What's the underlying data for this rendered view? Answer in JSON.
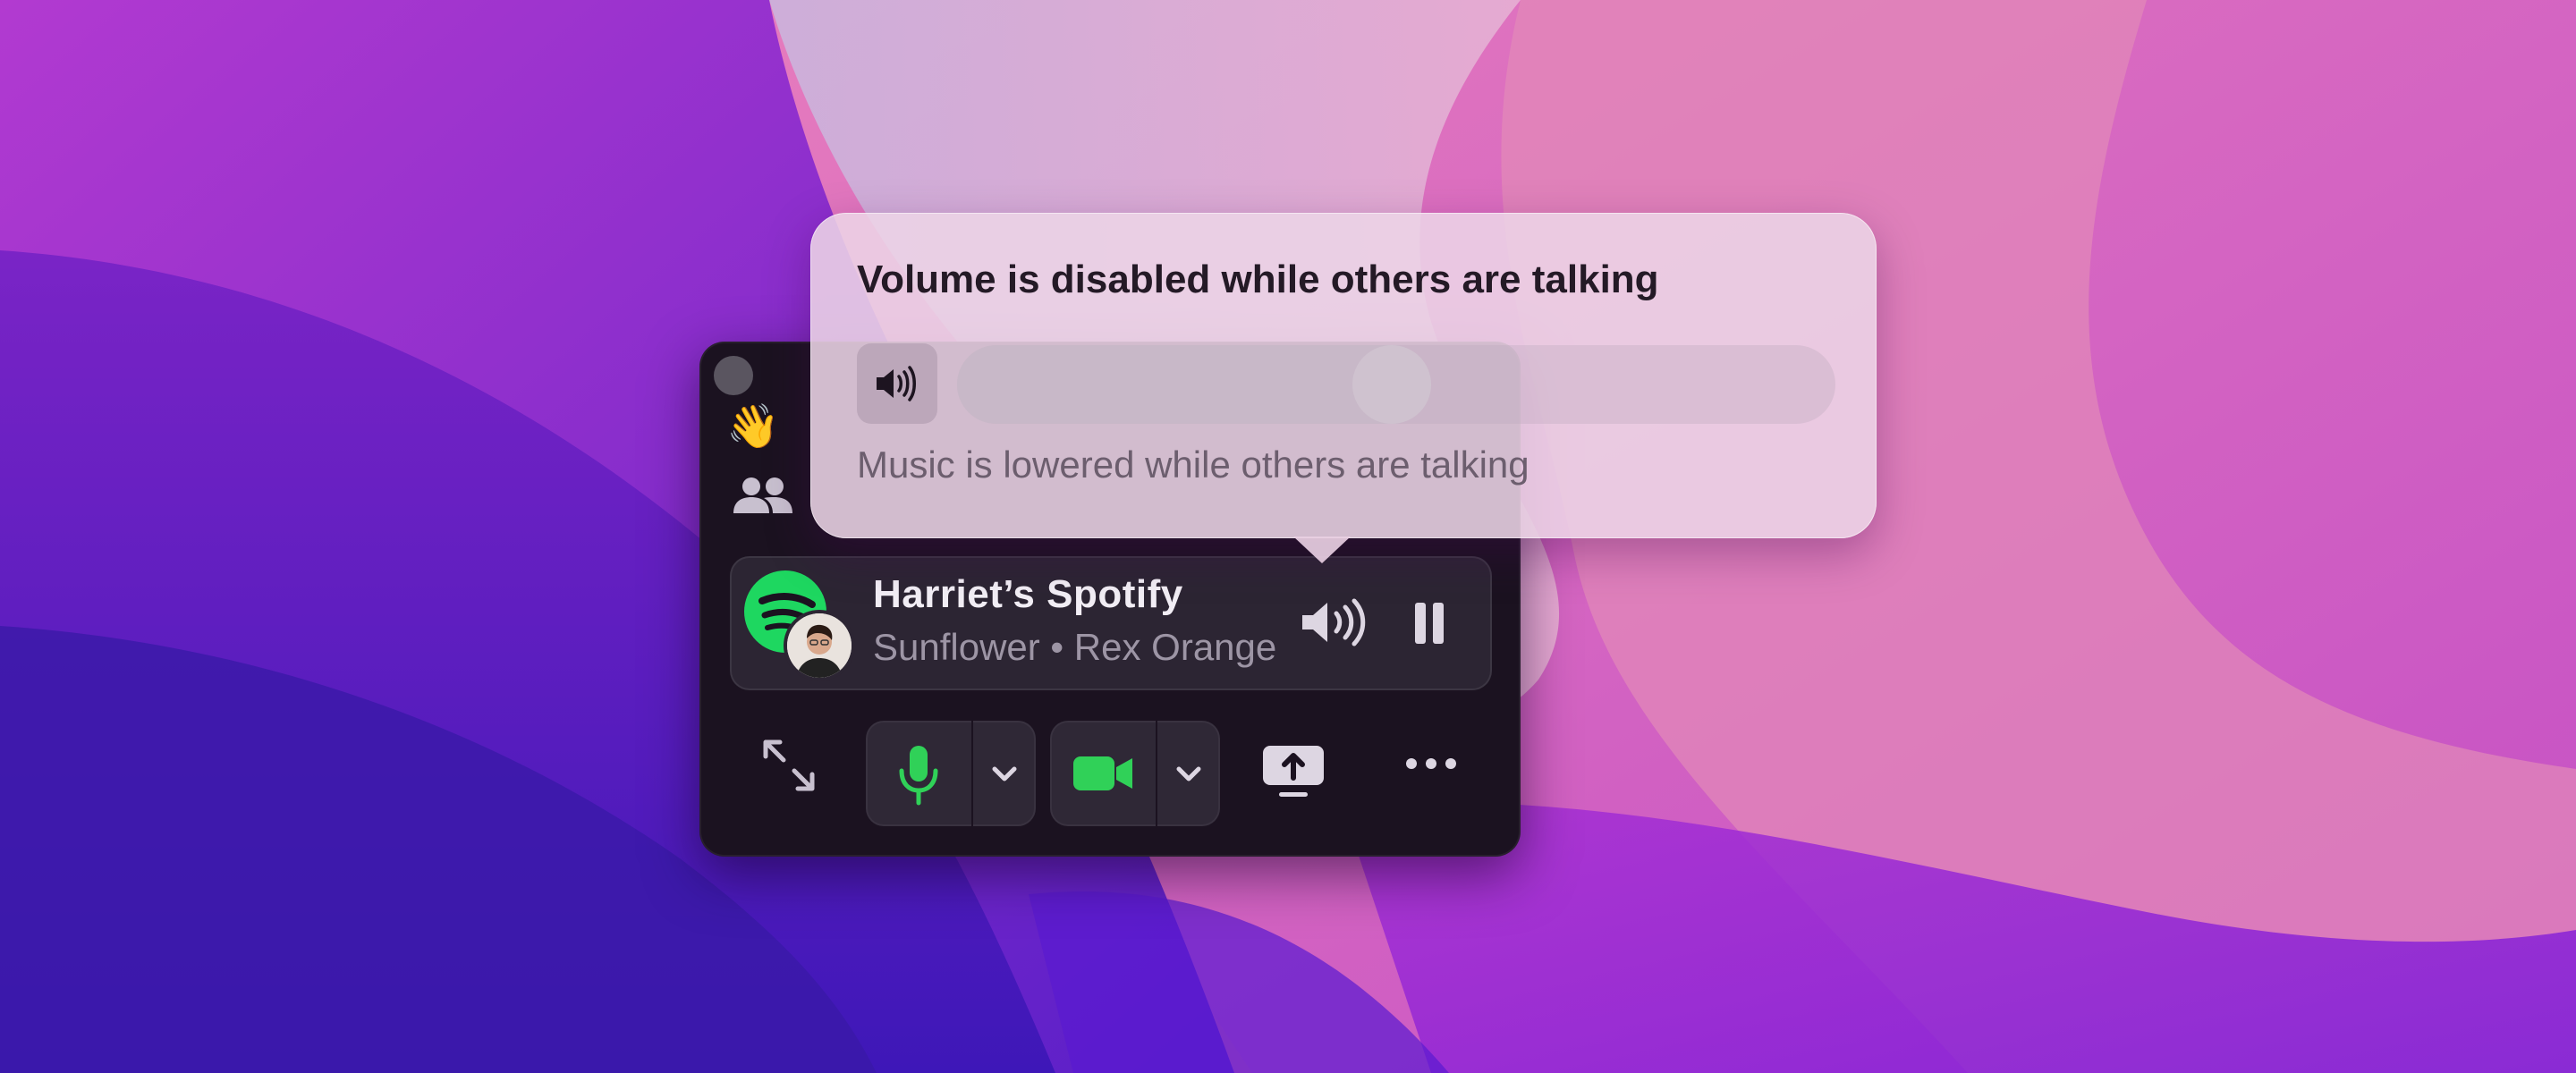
{
  "popover": {
    "title": "Volume is disabled while others are talking",
    "subtitle": "Music is lowered while others are talking",
    "volume_level": 0.5,
    "speaker_icon": "speaker-wave-icon"
  },
  "panel": {
    "wave_emoji": "👋",
    "people_icon": "people-icon",
    "now_playing": {
      "title": "Harriet’s Spotify",
      "subtitle": "Sunflower • Rex Orange County",
      "app_icon": "spotify-icon",
      "volume_icon": "speaker-wave-icon",
      "pause_icon": "pause-icon"
    },
    "toolbar": {
      "expand_icon": "expand-icon",
      "mic_icon": "microphone-icon",
      "camera_icon": "video-camera-icon",
      "share_icon": "screen-share-icon",
      "more_icon": "ellipsis-icon"
    }
  },
  "colors": {
    "accent_green": "#30d158",
    "spotify_green": "#1ed760"
  }
}
